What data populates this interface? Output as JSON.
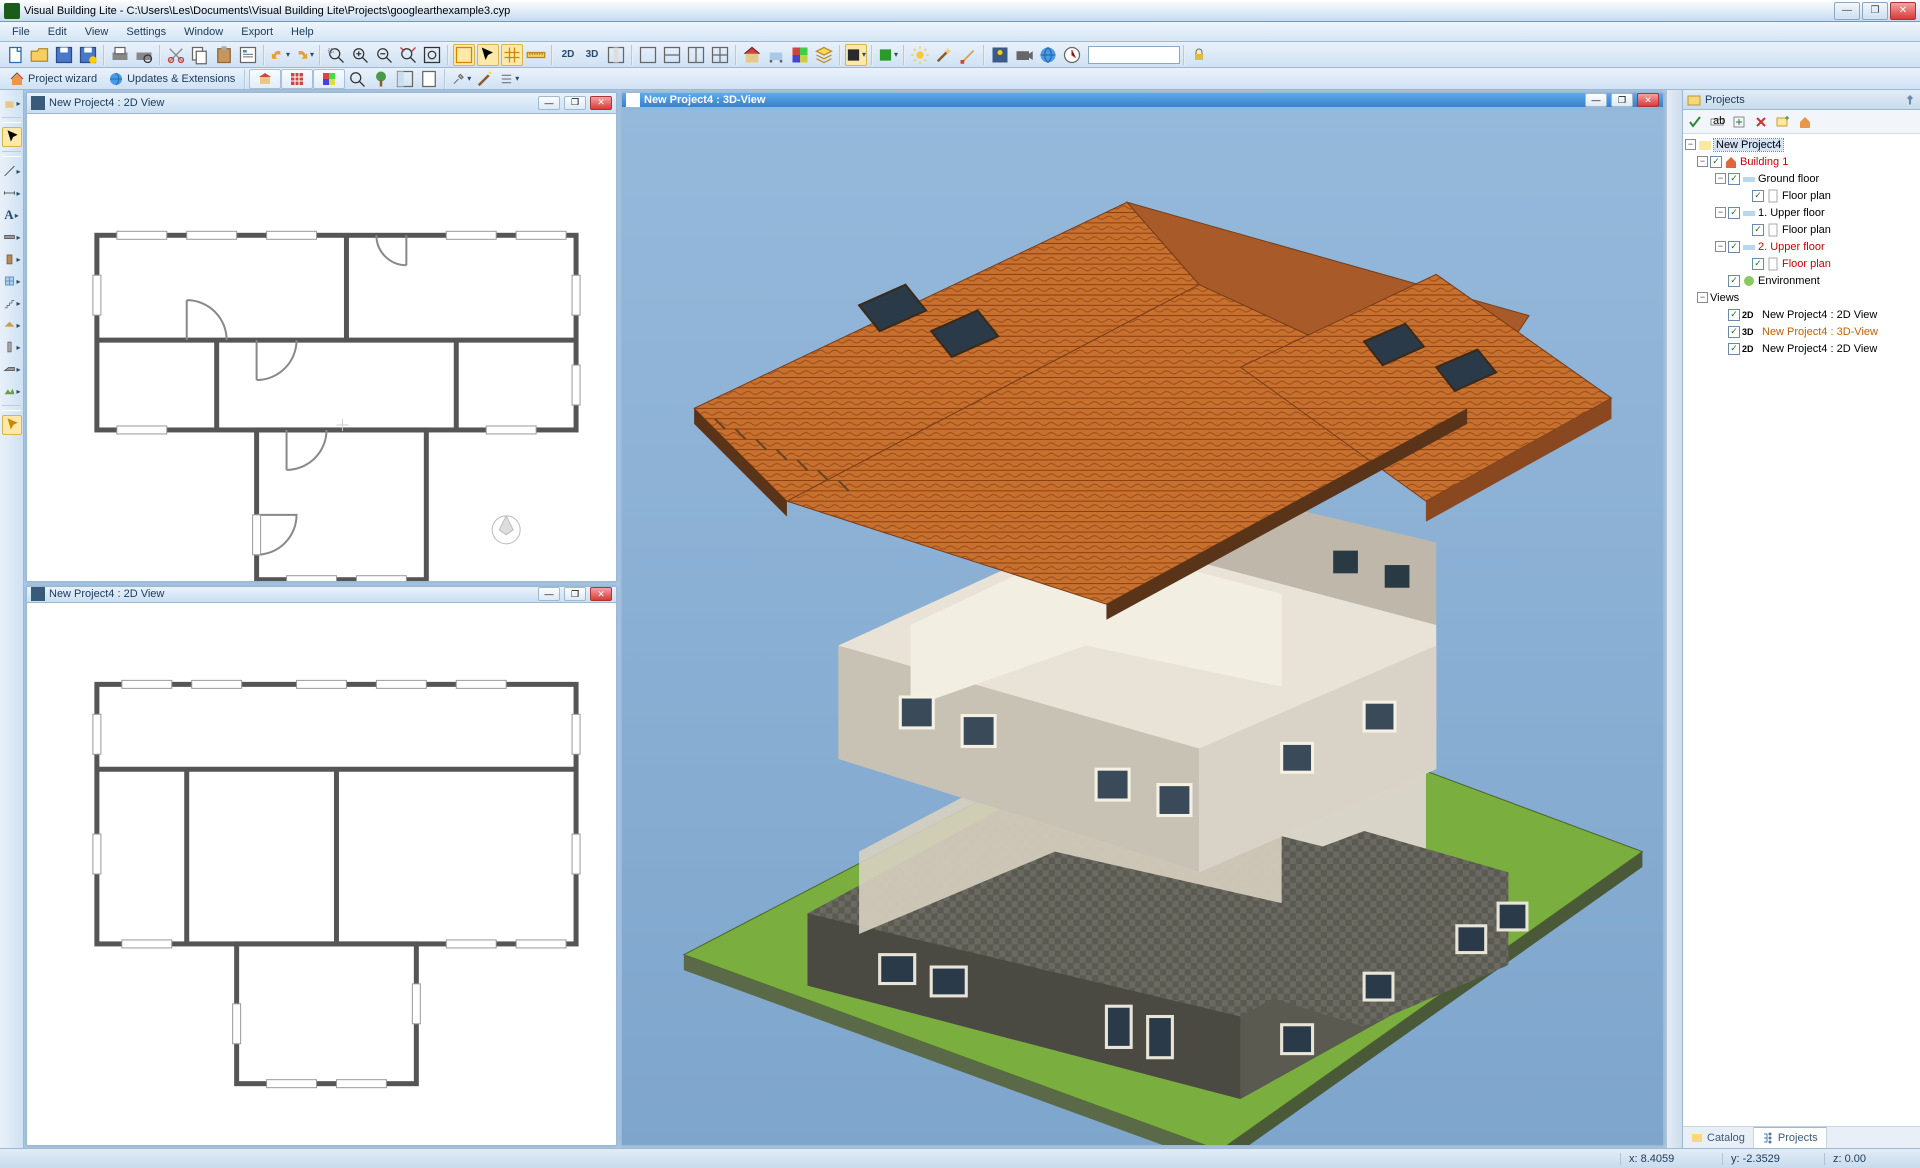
{
  "app": {
    "title": "Visual Building Lite - C:\\Users\\Les\\Documents\\Visual Building Lite\\Projects\\googlearthexample3.cyp"
  },
  "menu": [
    "File",
    "Edit",
    "View",
    "Settings",
    "Window",
    "Export",
    "Help"
  ],
  "toolbar2": {
    "project_wizard": "Project wizard",
    "updates": "Updates & Extensions"
  },
  "views": {
    "view2d_a": {
      "title": "New Project4 : 2D View"
    },
    "view2d_b": {
      "title": "New Project4 : 2D View"
    },
    "view3d": {
      "title": "New Project4 : 3D-View"
    }
  },
  "projects_panel": {
    "title": "Projects",
    "root": "New Project4",
    "building": "Building 1",
    "floors": [
      {
        "name": "Ground floor",
        "plan": "Floor plan"
      },
      {
        "name": "1. Upper floor",
        "plan": "Floor plan"
      },
      {
        "name": "2. Upper floor",
        "plan": "Floor plan"
      }
    ],
    "environment": "Environment",
    "views_label": "Views",
    "view_items": [
      {
        "tag": "2D",
        "label": "New Project4 : 2D View"
      },
      {
        "tag": "3D",
        "label": "New Project4 : 3D-View"
      },
      {
        "tag": "2D",
        "label": "New Project4 : 2D View"
      }
    ],
    "tabs": {
      "catalog": "Catalog",
      "projects": "Projects"
    }
  },
  "status": {
    "x": "x: 8.4059",
    "y": "y: -2.3529",
    "z": "z: 0.00"
  }
}
